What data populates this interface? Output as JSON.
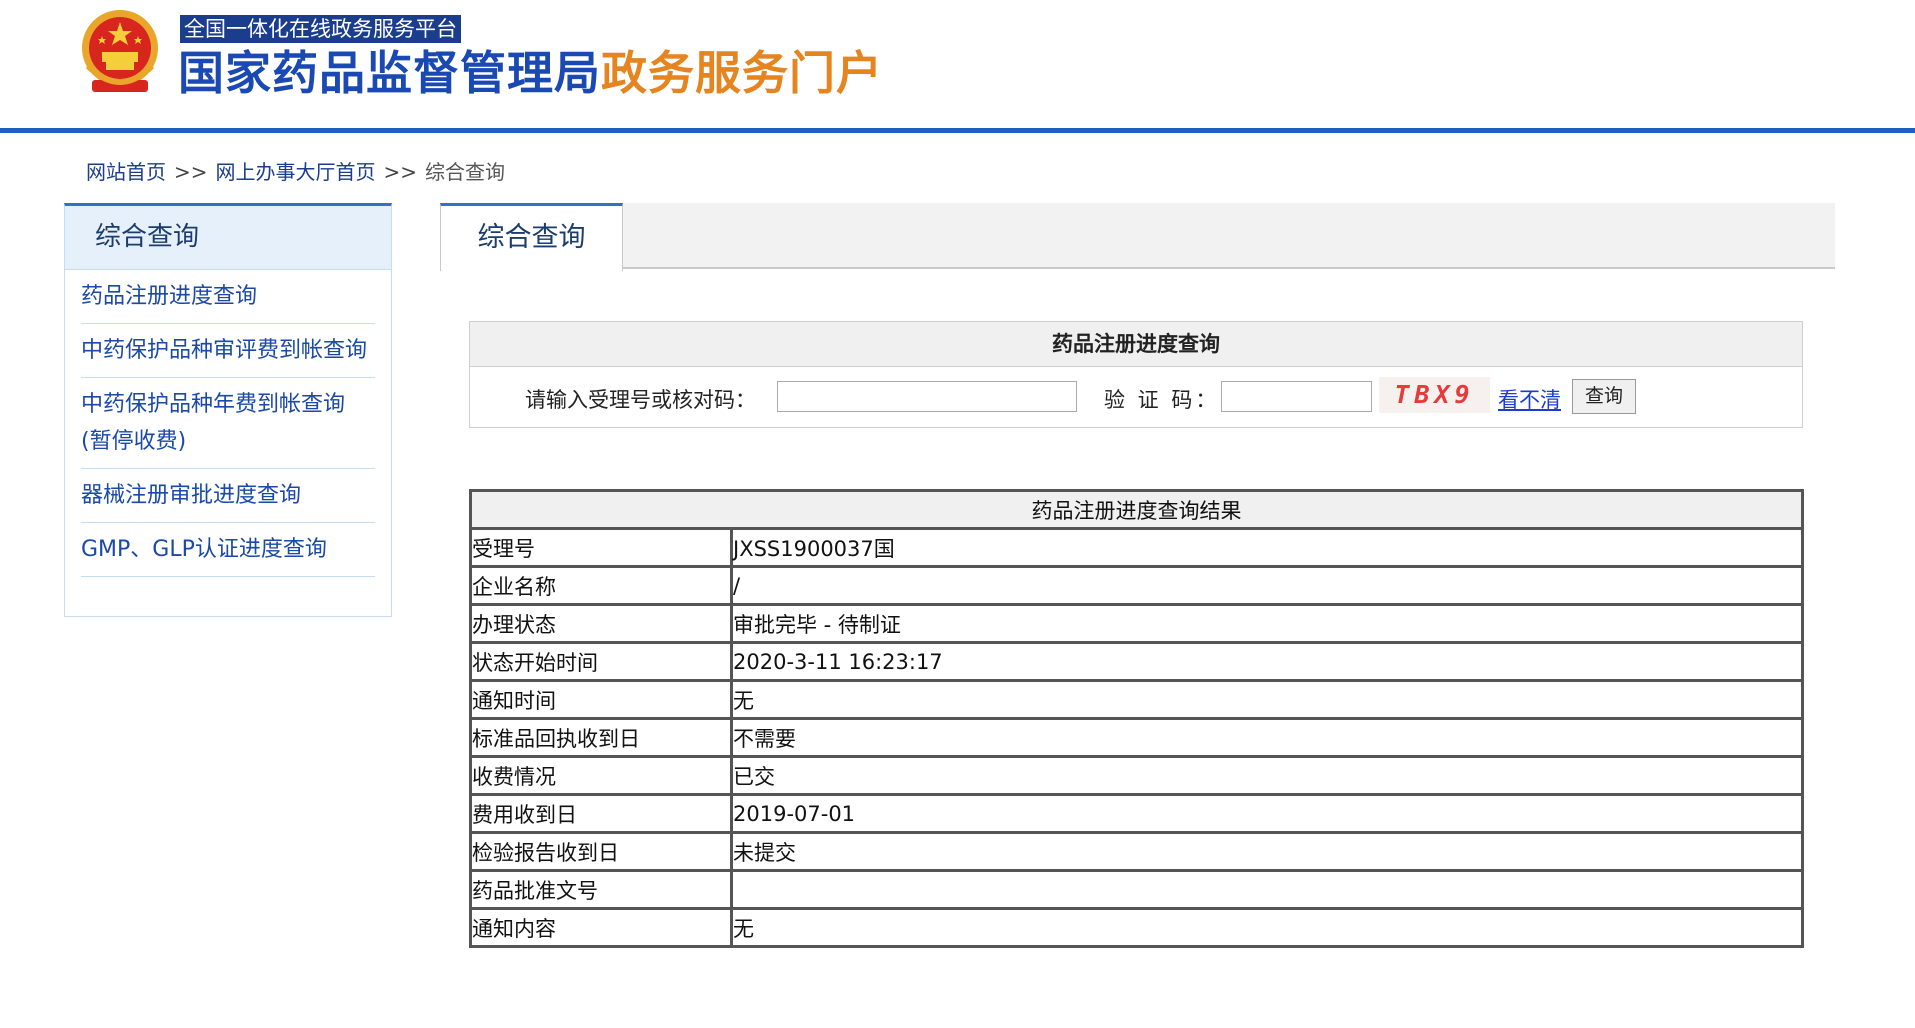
{
  "header": {
    "platform_tag": "全国一体化在线政务服务平台",
    "title_main": "国家药品监督管理局",
    "title_accent": "政务服务门户"
  },
  "breadcrumb": {
    "items": [
      "网站首页",
      "网上办事大厅首页"
    ],
    "separator": ">>",
    "current": "综合查询"
  },
  "sidebar": {
    "title": "综合查询",
    "items": [
      {
        "label": "药品注册进度查询"
      },
      {
        "label": "中药保护品种审评费到帐查询"
      },
      {
        "label": "中药保护品种年费到帐查询(暂停收费)"
      },
      {
        "label": "器械注册审批进度查询"
      },
      {
        "label": "GMP、GLP认证进度查询"
      }
    ]
  },
  "tabs": {
    "active_label": "综合查询"
  },
  "query": {
    "title": "药品注册进度查询",
    "id_label": "请输入受理号或核对码：",
    "id_value": "",
    "code_label": "验 证 码：",
    "code_value": "",
    "captcha_text": "TBX9",
    "refresh_label": "看不清",
    "submit_label": "查询"
  },
  "result": {
    "title": "药品注册进度查询结果",
    "rows": [
      {
        "label": "受理号",
        "value": "JXSS1900037国"
      },
      {
        "label": "企业名称",
        "value": "/"
      },
      {
        "label": "办理状态",
        "value": "审批完毕 - 待制证"
      },
      {
        "label": "状态开始时间",
        "value": "2020-3-11 16:23:17"
      },
      {
        "label": "通知时间",
        "value": "无"
      },
      {
        "label": "标准品回执收到日",
        "value": "不需要"
      },
      {
        "label": "收费情况",
        "value": "已交"
      },
      {
        "label": "费用收到日",
        "value": "2019-07-01"
      },
      {
        "label": "检验报告收到日",
        "value": "未提交"
      },
      {
        "label": "药品批准文号",
        "value": ""
      },
      {
        "label": "通知内容",
        "value": "无"
      }
    ]
  },
  "colors": {
    "brand_blue": "#1a49b4",
    "accent_orange": "#e6841f",
    "captcha_red": "#e63b3b"
  }
}
